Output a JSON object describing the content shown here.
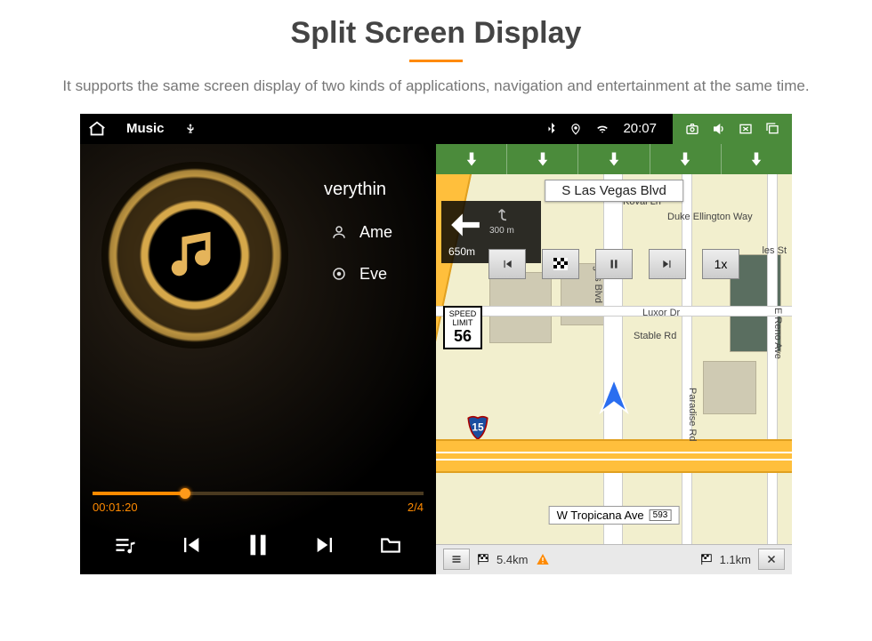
{
  "page": {
    "title": "Split Screen Display",
    "subtitle": "It supports the same screen display of two kinds of applications, navigation and entertainment at the same time."
  },
  "statusbar": {
    "app_label": "Music",
    "clock": "20:07"
  },
  "music": {
    "title_partial": "verythin",
    "artist_partial": "Ame",
    "album_partial": "Eve",
    "elapsed": "00:01:20",
    "track_index": "2/4"
  },
  "navigation": {
    "street_top": "S Las Vegas Blvd",
    "turn_distance": "650m",
    "exit_distance": "300 m",
    "speed_btn": "1x",
    "speed_limit_label": "SPEED LIMIT",
    "speed_limit_value": "56",
    "interstate_number": "15",
    "street_bottom": "W Tropicana Ave",
    "street_bottom_tag": "593",
    "bottom_left_distance": "5.4km",
    "bottom_right_distance": "1.1km",
    "map_labels": {
      "koval": "Koval Ln",
      "duke": "Duke Ellington Way",
      "vegas_blvd_v": "Vegas Blvd",
      "luxor": "Luxor Dr",
      "stable": "Stable Rd",
      "hles": "les St",
      "reno": "E Reno Ave",
      "paradise": "Paradise Rd"
    }
  }
}
